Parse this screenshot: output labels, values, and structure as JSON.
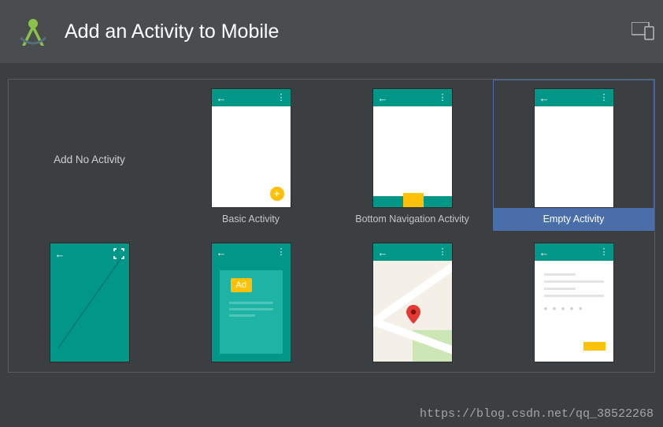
{
  "header": {
    "title": "Add an Activity to Mobile"
  },
  "templates": {
    "add_no": {
      "label": "Add No Activity"
    },
    "basic": {
      "label": "Basic Activity"
    },
    "bottom_nav": {
      "label": "Bottom Navigation Activity"
    },
    "empty": {
      "label": "Empty Activity",
      "selected": true
    },
    "fullscreen": {
      "label": ""
    },
    "ad": {
      "label": "",
      "badge": "Ad"
    },
    "map": {
      "label": ""
    },
    "login": {
      "label": ""
    }
  },
  "watermark": "https://blog.csdn.net/qq_38522268"
}
